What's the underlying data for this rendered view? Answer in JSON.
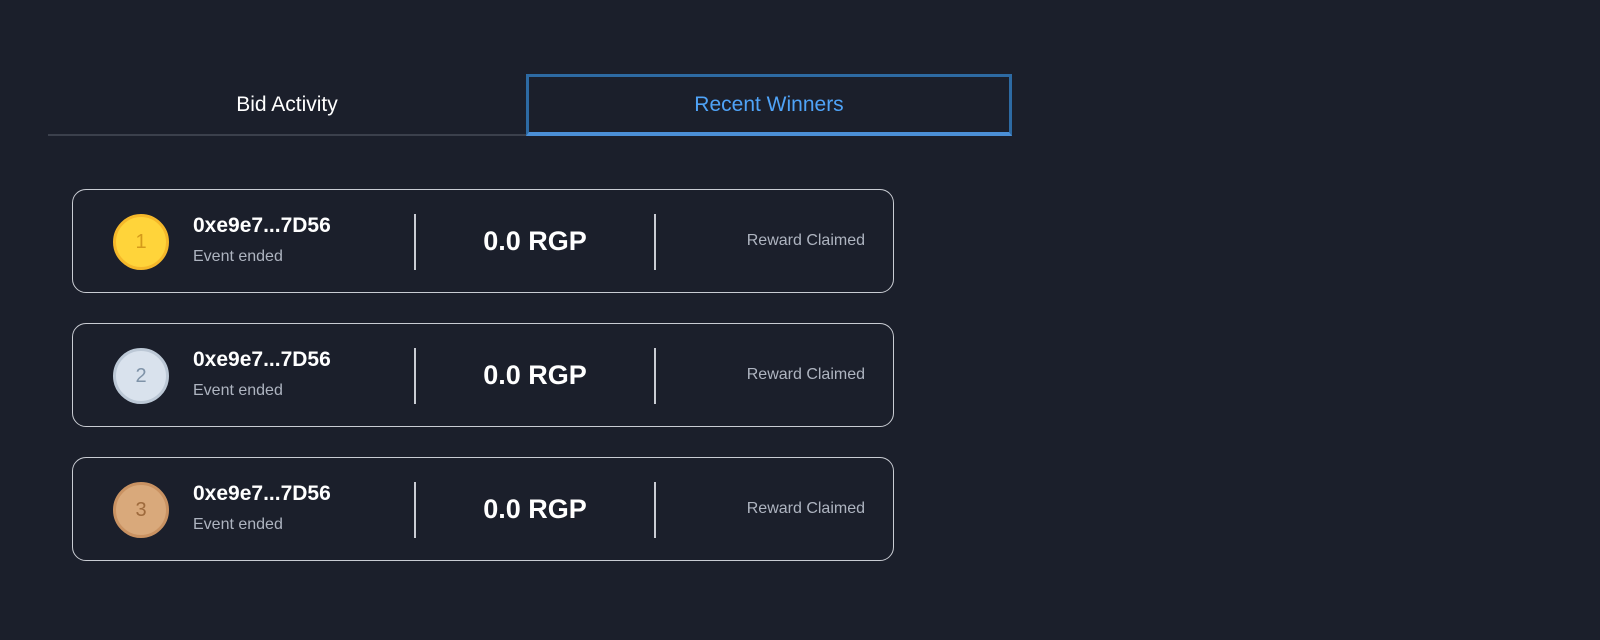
{
  "tabs": {
    "bid_activity": "Bid Activity",
    "recent_winners": "Recent Winners"
  },
  "winners": [
    {
      "rank": "1",
      "address": "0xe9e7...7D56",
      "subtitle": "Event ended",
      "amount": "0.0 RGP",
      "status": "Reward Claimed",
      "medal": "gold-medal-icon"
    },
    {
      "rank": "2",
      "address": "0xe9e7...7D56",
      "subtitle": "Event ended",
      "amount": "0.0 RGP",
      "status": "Reward Claimed",
      "medal": "silver-medal-icon"
    },
    {
      "rank": "3",
      "address": "0xe9e7...7D56",
      "subtitle": "Event ended",
      "amount": "0.0 RGP",
      "status": "Reward Claimed",
      "medal": "bronze-medal-icon"
    }
  ],
  "colors": {
    "background": "#1b1f2b",
    "active_tab_text": "#4fa3f7",
    "active_tab_border": "#2d6aa3",
    "gold": "#ffd43a",
    "silver": "#d9e2ed",
    "bronze": "#d9a97b"
  }
}
